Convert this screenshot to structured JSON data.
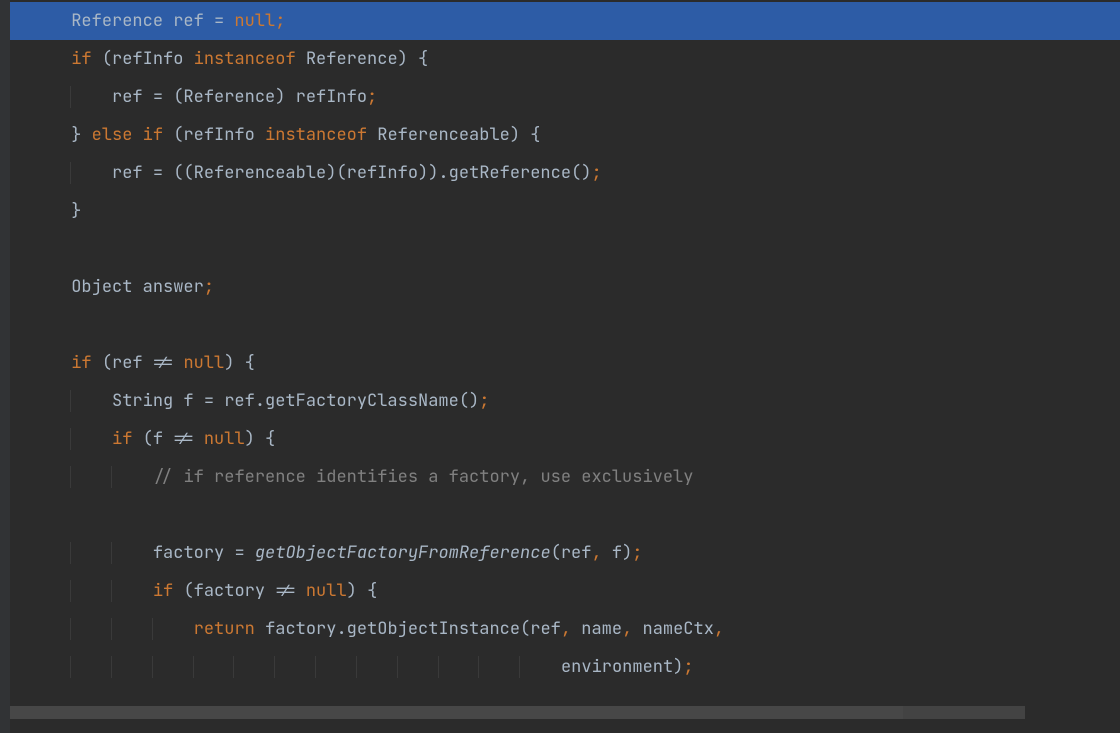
{
  "colors": {
    "background": "#2b2b2b",
    "gutter": "#313335",
    "selection": "#214283",
    "keyword": "#cc7832",
    "text": "#a9b7c6",
    "comment": "#808080"
  },
  "code": {
    "lines": [
      {
        "indent": 1,
        "tokens": [
          {
            "t": "Reference ref = ",
            "c": "type"
          },
          {
            "t": "null",
            "c": "nullkw"
          },
          {
            "t": ";",
            "c": "semi"
          }
        ],
        "highlighted": true
      },
      {
        "indent": 1,
        "tokens": [
          {
            "t": "if ",
            "c": "kw"
          },
          {
            "t": "(refInfo ",
            "c": "ident"
          },
          {
            "t": "instanceof ",
            "c": "kw"
          },
          {
            "t": "Reference) {",
            "c": "ident"
          }
        ]
      },
      {
        "indent": 2,
        "tokens": [
          {
            "t": "ref = (Reference) refInfo",
            "c": "ident"
          },
          {
            "t": ";",
            "c": "semi"
          }
        ]
      },
      {
        "indent": 1,
        "tokens": [
          {
            "t": "} ",
            "c": "ident"
          },
          {
            "t": "else if ",
            "c": "kw"
          },
          {
            "t": "(refInfo ",
            "c": "ident"
          },
          {
            "t": "instanceof ",
            "c": "kw"
          },
          {
            "t": "Referenceable) {",
            "c": "ident"
          }
        ]
      },
      {
        "indent": 2,
        "tokens": [
          {
            "t": "ref = ((Referenceable)(refInfo)).getReference()",
            "c": "ident"
          },
          {
            "t": ";",
            "c": "semi"
          }
        ]
      },
      {
        "indent": 1,
        "tokens": [
          {
            "t": "}",
            "c": "ident"
          }
        ]
      },
      {
        "indent": 0,
        "tokens": [
          {
            "t": "",
            "c": "ident"
          }
        ]
      },
      {
        "indent": 1,
        "tokens": [
          {
            "t": "Object answer",
            "c": "ident"
          },
          {
            "t": ";",
            "c": "semi"
          }
        ]
      },
      {
        "indent": 0,
        "tokens": [
          {
            "t": "",
            "c": "ident"
          }
        ]
      },
      {
        "indent": 1,
        "tokens": [
          {
            "t": "if ",
            "c": "kw"
          },
          {
            "t": "(ref != ",
            "c": "ident"
          },
          {
            "t": "null",
            "c": "nullkw"
          },
          {
            "t": ") {",
            "c": "ident"
          }
        ]
      },
      {
        "indent": 2,
        "tokens": [
          {
            "t": "String f = ref.getFactoryClassName()",
            "c": "ident"
          },
          {
            "t": ";",
            "c": "semi"
          }
        ]
      },
      {
        "indent": 2,
        "tokens": [
          {
            "t": "if ",
            "c": "kw"
          },
          {
            "t": "(f != ",
            "c": "ident"
          },
          {
            "t": "null",
            "c": "nullkw"
          },
          {
            "t": ") {",
            "c": "ident"
          }
        ]
      },
      {
        "indent": 3,
        "tokens": [
          {
            "t": "// if reference identifies a factory, use exclusively",
            "c": "comment"
          }
        ]
      },
      {
        "indent": 0,
        "tokens": [
          {
            "t": "",
            "c": "ident"
          }
        ]
      },
      {
        "indent": 3,
        "tokens": [
          {
            "t": "factory = ",
            "c": "ident"
          },
          {
            "t": "getObjectFactoryFromReference",
            "c": "italic-call"
          },
          {
            "t": "(ref",
            "c": "ident"
          },
          {
            "t": ", ",
            "c": "semi"
          },
          {
            "t": "f)",
            "c": "ident"
          },
          {
            "t": ";",
            "c": "semi"
          }
        ]
      },
      {
        "indent": 3,
        "tokens": [
          {
            "t": "if ",
            "c": "kw"
          },
          {
            "t": "(factory != ",
            "c": "ident"
          },
          {
            "t": "null",
            "c": "nullkw"
          },
          {
            "t": ") {",
            "c": "ident"
          }
        ]
      },
      {
        "indent": 4,
        "tokens": [
          {
            "t": "return ",
            "c": "kw"
          },
          {
            "t": "factory.getObjectInstance(ref",
            "c": "ident"
          },
          {
            "t": ", ",
            "c": "semi"
          },
          {
            "t": "name",
            "c": "ident"
          },
          {
            "t": ", ",
            "c": "semi"
          },
          {
            "t": "nameCtx",
            "c": "ident"
          },
          {
            "t": ",",
            "c": "semi"
          }
        ]
      },
      {
        "indent": 13,
        "tokens": [
          {
            "t": "environment)",
            "c": "ident"
          },
          {
            "t": ";",
            "c": "semi"
          }
        ],
        "half": true
      }
    ],
    "indent_unit": "    "
  }
}
